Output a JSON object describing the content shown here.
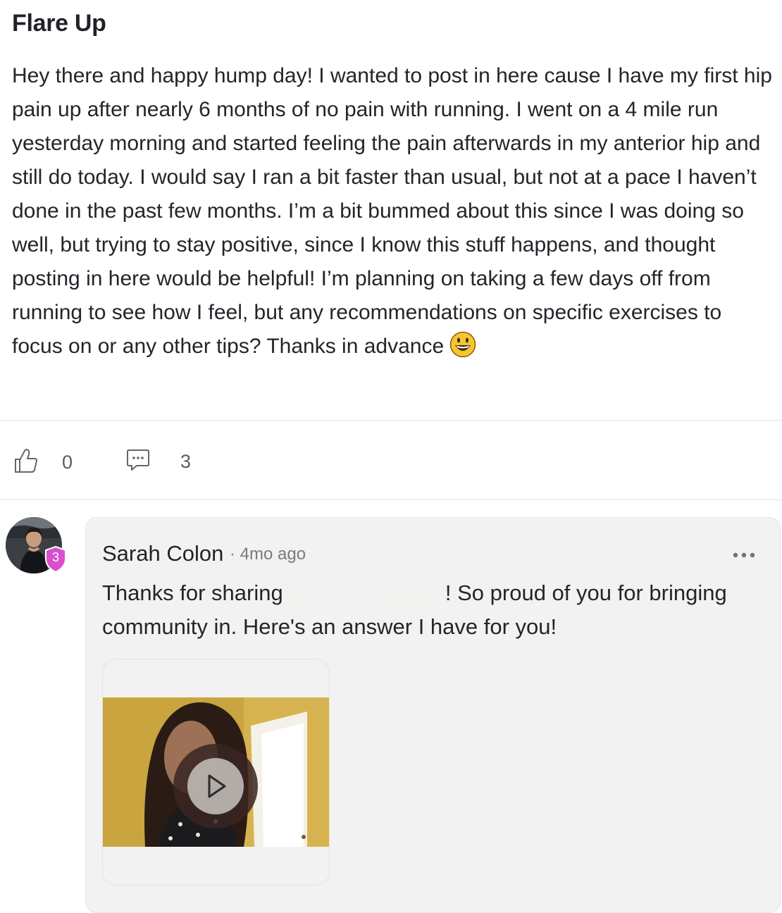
{
  "post": {
    "title": "Flare Up",
    "body": "Hey there and happy hump day! I wanted to post in here cause I have my first hip pain up after nearly 6 months of no pain with running. I went on a 4 mile run yesterday morning and started feeling the pain afterwards in my anterior hip and still do today. I would say I ran a bit faster than usual, but not at a pace I haven’t done in the past few months. I’m a bit bummed about this since I was doing so well, but trying to stay positive, since I know this stuff happens, and thought posting in here would be helpful! I’m planning on taking a few days off from running to see how I feel, but any recommendations on specific exercises to focus on or any other tips? Thanks in advance",
    "emoji": "grinning-face-emoji",
    "likes": "0",
    "comments": "3"
  },
  "comment": {
    "author": "Sarah Colon",
    "time": "· 4mo ago",
    "level": "3",
    "text_before": "Thanks for sharing ",
    "mention": "@Carly Wallace",
    "text_after": "! So proud of you for bringing community in. Here's an answer I have for you!",
    "attachment": "video",
    "icons": [
      "thumbs-up-icon",
      "comment-icon",
      "more-icon",
      "play-icon"
    ]
  },
  "colors": {
    "badge": "#d94fd0",
    "card": "#f2f2f2",
    "text": "#22252a",
    "muted": "#777b80"
  }
}
